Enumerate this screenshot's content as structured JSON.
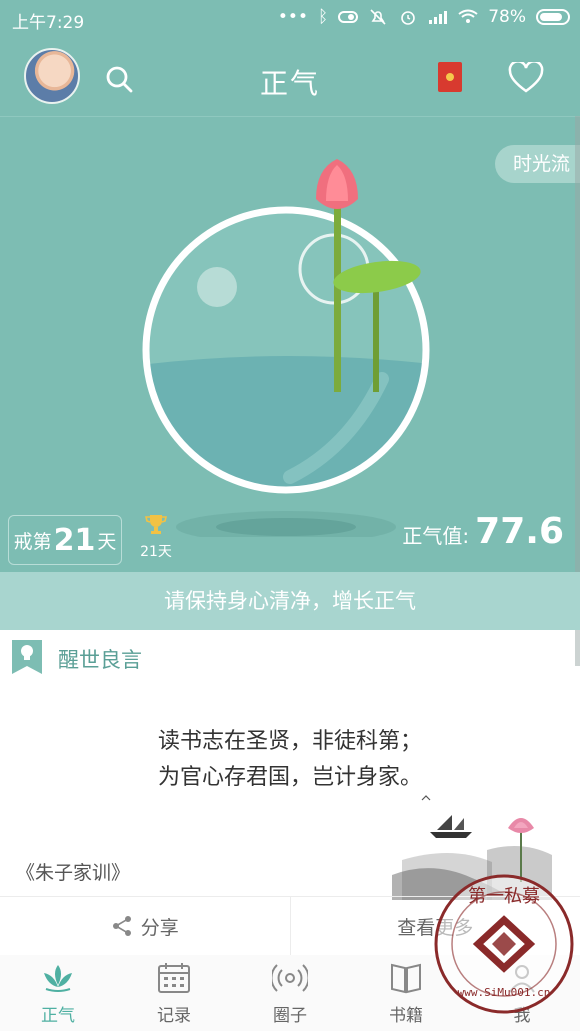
{
  "status_bar": {
    "time": "上午7:29",
    "battery": "78%"
  },
  "header": {
    "title": "正气"
  },
  "hero": {
    "timeline_label": "时光流",
    "days_prefix": "戒第",
    "days_count": "21",
    "days_suffix": "天",
    "trophy_label": "21天",
    "qi_label": "正气值:",
    "qi_value": "77.6"
  },
  "banner": {
    "text": "请保持身心清净，增长正气"
  },
  "quote_card": {
    "title": "醒世良言",
    "lines": [
      "读书志在圣贤，非徒科第；",
      "为官心存君国，岂计身家。"
    ],
    "source": "《朱子家训》"
  },
  "actions": {
    "share_label": "分享",
    "more_label": "查看更多"
  },
  "tabs": [
    {
      "label": "正气",
      "icon": "lotus-icon",
      "active": true
    },
    {
      "label": "记录",
      "icon": "calendar-icon"
    },
    {
      "label": "圈子",
      "icon": "signal-icon"
    },
    {
      "label": "书籍",
      "icon": "book-icon"
    },
    {
      "label": "我",
      "icon": "user-icon"
    }
  ],
  "watermark": {
    "center": "第一私募",
    "url": "www.SiMu001.cn"
  },
  "colors": {
    "teal": "#7dbdb3",
    "accent": "#4fb0a2",
    "banner": "#a8d5cf"
  }
}
